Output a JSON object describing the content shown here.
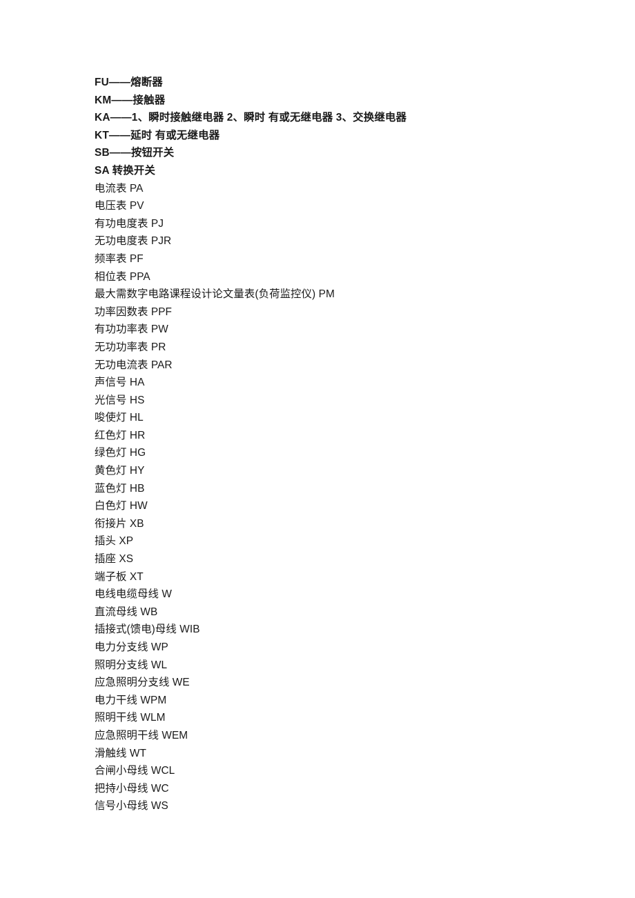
{
  "document": {
    "lines": [
      {
        "text": "FU——熔断器",
        "style": "code-lead"
      },
      {
        "text": "KM——接触器",
        "style": "code-lead"
      },
      {
        "text": "KA——1、瞬时接触继电器 2、瞬时 有或无继电器 3、交换继电器",
        "style": "code-lead"
      },
      {
        "text": "KT——延时 有或无继电器",
        "style": "code-lead"
      },
      {
        "text": "SB——按钮开关",
        "style": "code-lead"
      },
      {
        "text": "SA 转换开关",
        "style": "code-lead"
      },
      {
        "text": "电流表 PA",
        "style": "normal"
      },
      {
        "text": "电压表 PV",
        "style": "normal"
      },
      {
        "text": "有功电度表 PJ",
        "style": "normal"
      },
      {
        "text": "无功电度表 PJR",
        "style": "normal"
      },
      {
        "text": "频率表 PF",
        "style": "normal"
      },
      {
        "text": "相位表 PPA",
        "style": "normal"
      },
      {
        "text": "最大需数字电路课程设计论文量表(负荷监控仪) PM",
        "style": "normal"
      },
      {
        "text": "功率因数表 PPF",
        "style": "normal"
      },
      {
        "text": "有功功率表 PW",
        "style": "normal"
      },
      {
        "text": "无功功率表 PR",
        "style": "normal"
      },
      {
        "text": "无功电流表 PAR",
        "style": "normal"
      },
      {
        "text": "声信号 HA",
        "style": "normal"
      },
      {
        "text": "光信号 HS",
        "style": "normal"
      },
      {
        "text": "唆使灯 HL",
        "style": "normal"
      },
      {
        "text": "红色灯 HR",
        "style": "normal"
      },
      {
        "text": "绿色灯 HG",
        "style": "normal"
      },
      {
        "text": "黄色灯 HY",
        "style": "normal"
      },
      {
        "text": "蓝色灯 HB",
        "style": "normal"
      },
      {
        "text": "白色灯 HW",
        "style": "normal"
      },
      {
        "text": "衔接片 XB",
        "style": "normal"
      },
      {
        "text": "插头 XP",
        "style": "normal"
      },
      {
        "text": "插座 XS",
        "style": "normal"
      },
      {
        "text": "端子板 XT",
        "style": "normal"
      },
      {
        "text": "电线电缆母线 W",
        "style": "normal"
      },
      {
        "text": "直流母线 WB",
        "style": "normal"
      },
      {
        "text": "插接式(馈电)母线 WIB",
        "style": "normal"
      },
      {
        "text": "电力分支线 WP",
        "style": "normal"
      },
      {
        "text": "照明分支线 WL",
        "style": "normal"
      },
      {
        "text": "应急照明分支线 WE",
        "style": "normal"
      },
      {
        "text": "电力干线 WPM",
        "style": "normal"
      },
      {
        "text": "照明干线 WLM",
        "style": "normal"
      },
      {
        "text": "应急照明干线 WEM",
        "style": "normal"
      },
      {
        "text": "滑触线 WT",
        "style": "normal"
      },
      {
        "text": "合闸小母线 WCL",
        "style": "normal"
      },
      {
        "text": "把持小母线 WC",
        "style": "normal"
      },
      {
        "text": "信号小母线 WS",
        "style": "normal"
      }
    ]
  }
}
